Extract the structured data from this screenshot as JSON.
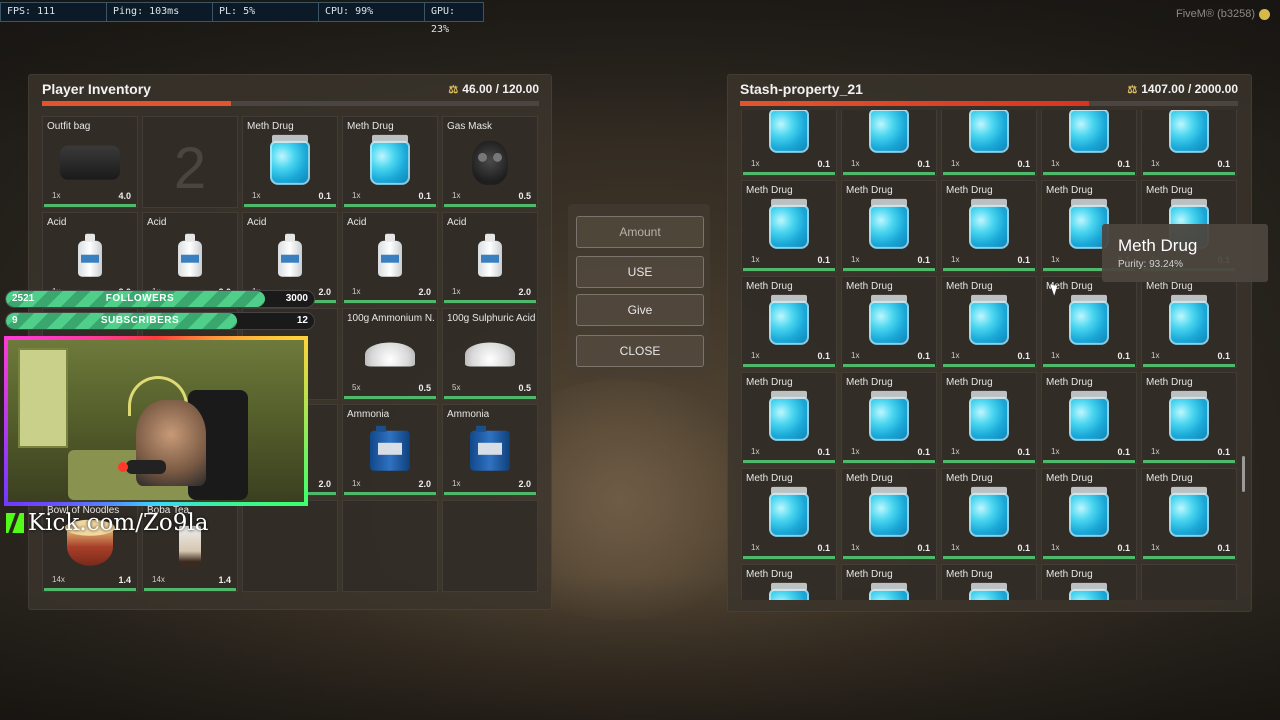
{
  "perf": [
    {
      "label": "FPS: 111"
    },
    {
      "label": "Ping: 103ms"
    },
    {
      "label": "PL: 5%"
    },
    {
      "label": "CPU: 99%"
    },
    {
      "label": "GPU: 23%"
    }
  ],
  "brand": "FiveM® (b3258)",
  "player": {
    "title": "Player Inventory",
    "weight": "46.00 / 120.00",
    "weight_fraction": 0.38,
    "weight_color": "#e2542e",
    "slots": [
      {
        "name": "Outfit bag",
        "qty": "1x",
        "wt": "4.0",
        "icon": "duffel-bag-icon"
      },
      {
        "name": "",
        "qty": "",
        "wt": "",
        "icon": "",
        "slot_no": "2"
      },
      {
        "name": "Meth Drug",
        "qty": "1x",
        "wt": "0.1",
        "icon": "meth-bag-icon"
      },
      {
        "name": "Meth Drug",
        "qty": "1x",
        "wt": "0.1",
        "icon": "meth-bag-icon"
      },
      {
        "name": "Gas Mask",
        "qty": "1x",
        "wt": "0.5",
        "icon": "gas-mask-icon"
      },
      {
        "name": "Acid",
        "qty": "1x",
        "wt": "2.0",
        "icon": "jug-icon"
      },
      {
        "name": "Acid",
        "qty": "1x",
        "wt": "2.0",
        "icon": "jug-icon"
      },
      {
        "name": "Acid",
        "qty": "1x",
        "wt": "2.0",
        "icon": "jug-icon"
      },
      {
        "name": "Acid",
        "qty": "1x",
        "wt": "2.0",
        "icon": "jug-icon"
      },
      {
        "name": "Acid",
        "qty": "1x",
        "wt": "2.0",
        "icon": "jug-icon"
      },
      {
        "name": "",
        "qty": "",
        "wt": "",
        "icon": ""
      },
      {
        "name": "",
        "qty": "",
        "wt": "",
        "icon": ""
      },
      {
        "name": "",
        "qty": "",
        "wt": "",
        "icon": ""
      },
      {
        "name": "100g Ammonium N...",
        "qty": "5x",
        "wt": "0.5",
        "icon": "powder-icon"
      },
      {
        "name": "100g Sulphuric Acid",
        "qty": "5x",
        "wt": "0.5",
        "icon": "powder-icon"
      },
      {
        "name": "",
        "qty": "",
        "wt": "",
        "icon": ""
      },
      {
        "name": "",
        "qty": "",
        "wt": "",
        "icon": ""
      },
      {
        "name": "",
        "qty": "",
        "wt": "2.0",
        "icon": ""
      },
      {
        "name": "Ammonia",
        "qty": "1x",
        "wt": "2.0",
        "icon": "canister-icon"
      },
      {
        "name": "Ammonia",
        "qty": "1x",
        "wt": "2.0",
        "icon": "canister-icon"
      },
      {
        "name": "Bowl of Noodles",
        "qty": "14x",
        "wt": "1.4",
        "icon": "bowl-icon"
      },
      {
        "name": "Boba Tea",
        "qty": "14x",
        "wt": "1.4",
        "icon": "boba-icon"
      },
      {
        "name": "",
        "qty": "",
        "wt": "",
        "icon": ""
      },
      {
        "name": "",
        "qty": "",
        "wt": "",
        "icon": ""
      },
      {
        "name": "",
        "qty": "",
        "wt": "",
        "icon": ""
      }
    ]
  },
  "actions": {
    "amount_placeholder": "Amount",
    "use": "USE",
    "give": "Give",
    "close": "CLOSE"
  },
  "stash": {
    "title": "Stash-property_21",
    "weight": "1407.00 / 2000.00",
    "weight_fraction": 0.7,
    "weight_color": "#d83420",
    "item_name": "Meth Drug",
    "item_qty": "1x",
    "item_wt": "0.1",
    "rows": 6
  },
  "tooltip": {
    "title": "Meth Drug",
    "subtitle": "Purity: 93.24%"
  },
  "overlay": {
    "followers": {
      "count": "2521",
      "label": "FOLLOWERS",
      "goal": "3000",
      "fraction": 0.84
    },
    "subscribers": {
      "count": "9",
      "label": "SUBSCRIBERS",
      "goal": "12",
      "fraction": 0.75
    },
    "kick": "Kick.com/Zo9la"
  }
}
